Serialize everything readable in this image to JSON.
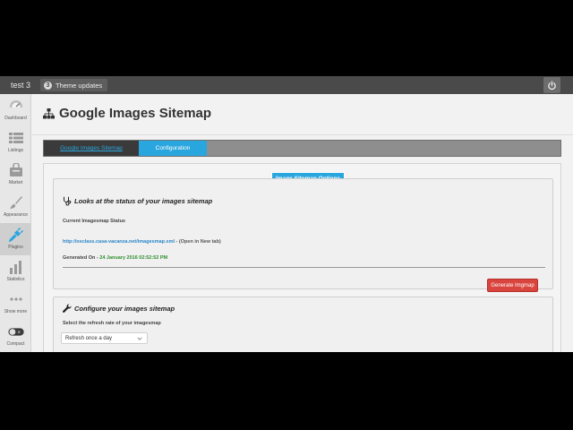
{
  "topbar": {
    "site_name": "test 3",
    "theme_updates": {
      "count": "3",
      "label": "Theme updates"
    },
    "power_icon": "power-icon"
  },
  "sidebar": {
    "items": [
      {
        "label": "Dashboard",
        "icon": "dashboard-icon",
        "active": false
      },
      {
        "label": "Listings",
        "icon": "list-icon",
        "active": false
      },
      {
        "label": "Market",
        "icon": "market-icon",
        "active": false
      },
      {
        "label": "Appearance",
        "icon": "brush-icon",
        "active": false
      },
      {
        "label": "Plugins",
        "icon": "plug-icon",
        "active": true
      },
      {
        "label": "Statistics",
        "icon": "bar-chart-icon",
        "active": false
      },
      {
        "label": "Show more",
        "icon": "ellipsis-icon",
        "active": false
      },
      {
        "label": "Compact",
        "icon": "toggle-icon",
        "active": false
      }
    ]
  },
  "page": {
    "title": "Google Images Sitemap",
    "title_icon": "sitemap-icon"
  },
  "tabs": [
    {
      "label": "Google Images Sitemap",
      "active": false
    },
    {
      "label": "Configuration",
      "active": true
    }
  ],
  "options_badge": "Image Sitemap Options",
  "status_section": {
    "title": "Looks at the status of your images sitemap",
    "title_icon": "stethoscope-icon",
    "current_label": "Current Imagesmap Status",
    "sitemap_url": "http://osclass.casa-vacanza.net/imagesmap.xml",
    "open_new_tab": " - (Open in New tab)",
    "generated_label": "Generated On - ",
    "generated_date": "24 January 2016 02:52:52 PM",
    "generate_button": "Generate Imgmap"
  },
  "config_section": {
    "title": "Configure your images sitemap",
    "title_icon": "wrench-icon",
    "refresh_label": "Select the refresh rate of your imagesmap",
    "refresh_value": "Refresh once a day"
  },
  "colors": {
    "accent": "#2aa6de",
    "danger": "#d9453e",
    "success": "#2f8f2f",
    "link": "#2a85c8"
  }
}
